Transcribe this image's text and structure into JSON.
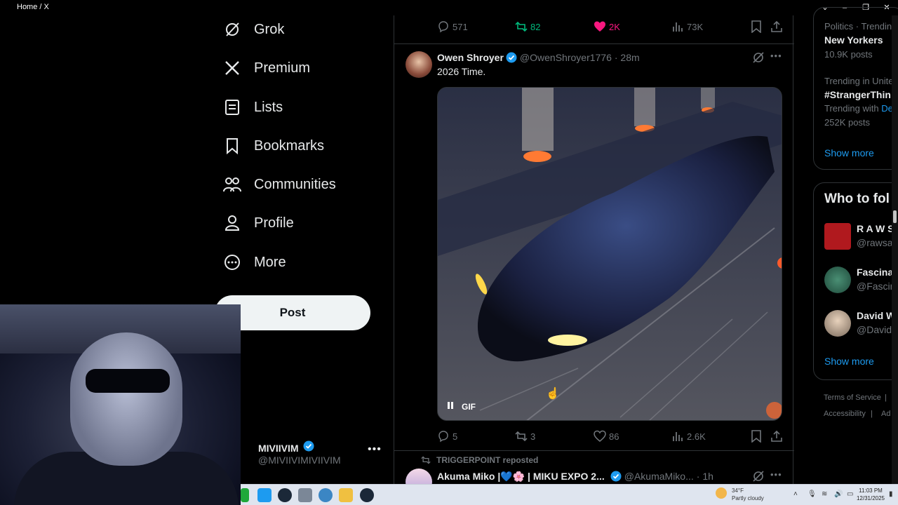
{
  "window": {
    "title": "Home / X"
  },
  "nav": {
    "items": [
      {
        "label": "Grok",
        "icon": "grok-icon"
      },
      {
        "label": "Premium",
        "icon": "x-logo-icon"
      },
      {
        "label": "Lists",
        "icon": "lists-icon"
      },
      {
        "label": "Bookmarks",
        "icon": "bookmark-icon"
      },
      {
        "label": "Communities",
        "icon": "communities-icon"
      },
      {
        "label": "Profile",
        "icon": "profile-icon"
      },
      {
        "label": "More",
        "icon": "more-circle-icon"
      }
    ],
    "post_label": "Post",
    "account": {
      "name": "MIVIIVIM",
      "handle": "@MIVIIVIMIVIIVIM"
    }
  },
  "feed": {
    "prev_stats": {
      "replies": "571",
      "reposts": "82",
      "likes": "2K",
      "views": "73K"
    },
    "tweet": {
      "name": "Owen Shroyer",
      "handle": "@OwenShroyer1776",
      "time": "· 28m",
      "text": "2026 Time.",
      "media_tag": "GIF",
      "stats": {
        "replies": "5",
        "reposts": "3",
        "likes": "86",
        "views": "2.6K"
      }
    },
    "next": {
      "repost_note": "TRIGGERPOINT reposted",
      "name": "Akuma Miko |💙🌸 | MIKU EXPO 2...",
      "handle": "@AkumaMiko...",
      "time": "· 1h"
    }
  },
  "right": {
    "trends": [
      {
        "meta": "Politics · Trendin",
        "title": "New Yorkers",
        "count": "10.9K posts"
      },
      {
        "meta": "Trending in Unite",
        "title": "#StrangerThin",
        "extra": "Trending with",
        "extra_link": "De",
        "count": "252K posts"
      }
    ],
    "show_more": "Show more",
    "who_title": "Who to fol",
    "who": [
      {
        "name": "R A W S",
        "handle": "@rawsa",
        "avatar_color": "#b0191e"
      },
      {
        "name": "Fascina",
        "handle": "@Fascin",
        "avatar_color": "#2f6b57"
      },
      {
        "name": "David W",
        "handle": "@David",
        "avatar_color": "#d9c7b0"
      }
    ],
    "show_more_2": "Show more",
    "footer": [
      "Terms of Service",
      "|",
      "Accessibility",
      "|",
      "Ad"
    ]
  },
  "taskbar": {
    "weather_temp": "34°F",
    "weather_text": "Partly cloudy",
    "time": "11:03 PM",
    "date": "12/31/2025"
  },
  "colors": {
    "accent": "#1d9bf0",
    "like": "#f91880",
    "repost": "#00ba7c",
    "verified": "#1d9bf0"
  }
}
